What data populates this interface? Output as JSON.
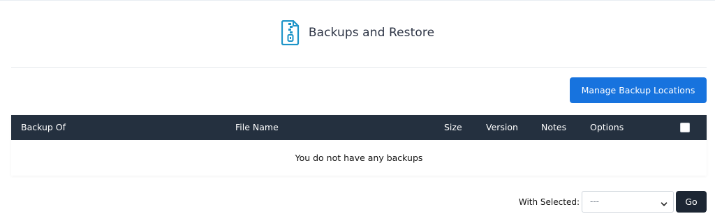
{
  "header": {
    "title": "Backups and Restore",
    "icon": "zip-file-icon",
    "icon_color": "#1d94c8"
  },
  "toolbar": {
    "manage_label": "Manage Backup Locations",
    "accent_color": "#1773de"
  },
  "table": {
    "columns": [
      "Backup Of",
      "File Name",
      "Size",
      "Version",
      "Notes",
      "Options"
    ],
    "header_bg": "#24303f",
    "empty_message": "You do not have any backups"
  },
  "bulk": {
    "label": "With Selected:",
    "selected_value": "---",
    "go_label": "Go"
  }
}
